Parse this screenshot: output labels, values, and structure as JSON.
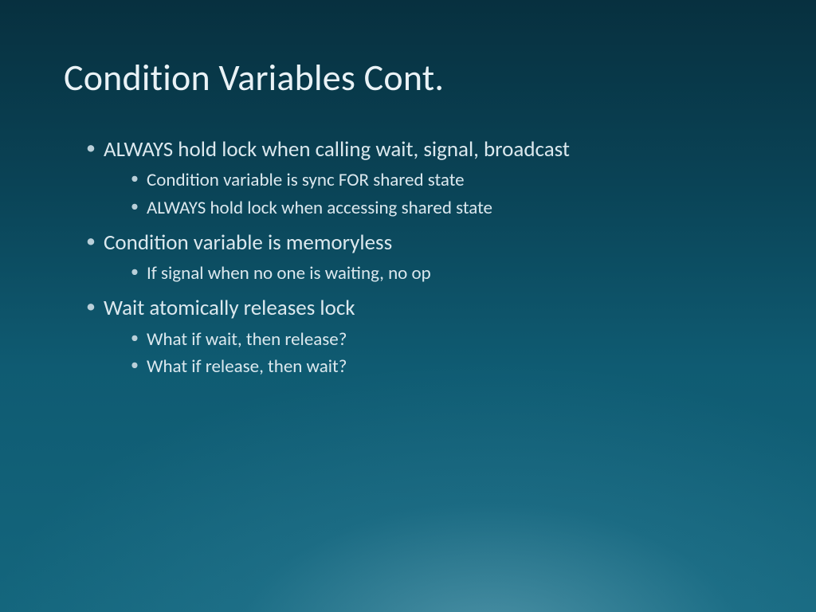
{
  "title": "Condition Variables Cont.",
  "bullets": [
    {
      "text": "ALWAYS hold lock when calling wait, signal, broadcast",
      "sub": [
        "Condition variable is sync FOR shared state",
        "ALWAYS hold lock when accessing shared state"
      ]
    },
    {
      "text": "Condition variable is memoryless",
      "sub": [
        "If signal when no one is waiting, no op"
      ]
    },
    {
      "text": "Wait atomically releases lock",
      "sub": [
        "What if wait, then release?",
        "What if release, then wait?"
      ]
    }
  ]
}
